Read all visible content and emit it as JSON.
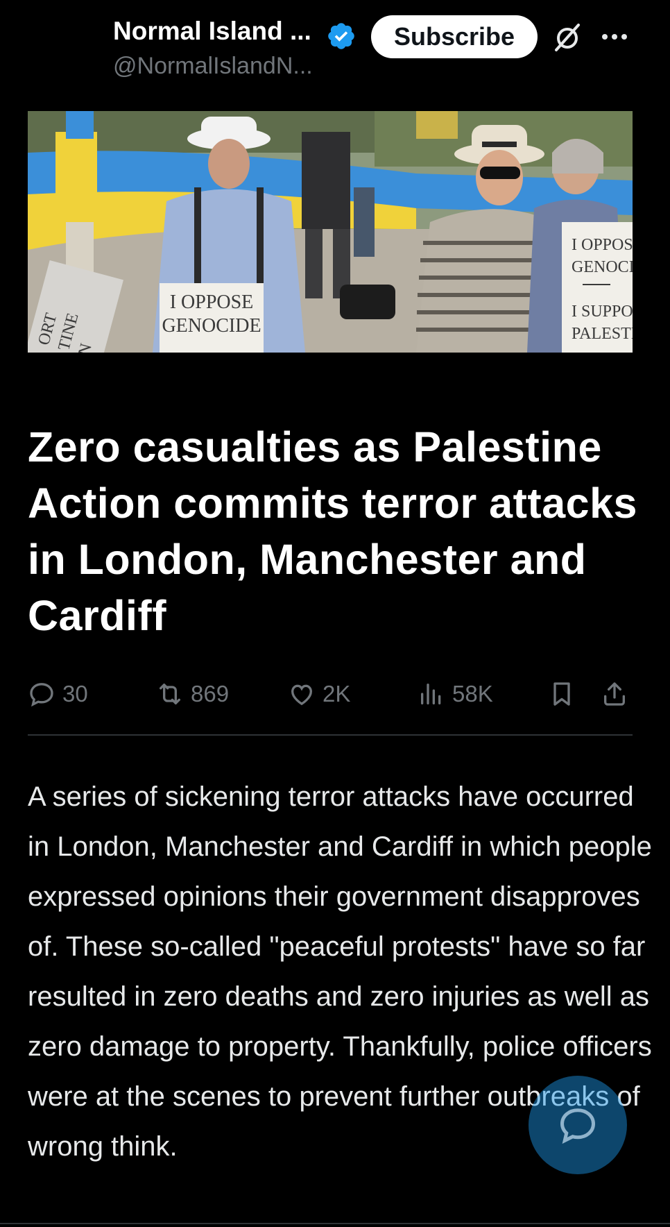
{
  "header": {
    "account_name": "Normal Island ...",
    "handle": "@NormalIslandN...",
    "subscribe_label": "Subscribe"
  },
  "hero_image": {
    "signs": [
      "I OPPOSE",
      "GENOCIDE",
      "I OPPOS",
      "GENOCI",
      "I SUPPO",
      "PALESTI",
      "ORT",
      "TINE",
      "N"
    ]
  },
  "article": {
    "title": "Zero casualties as Palestine Action commits terror attacks in London, Manchester and Cardiff",
    "body": "A series of sickening terror attacks have occurred in London, Manchester and Cardiff in which people expressed opinions their government disapproves of. These so-called \"peaceful protests\" have so far resulted in zero deaths and zero injuries as well as zero damage to property. Thankfully, police officers were at the scenes to prevent further outbreaks of wrong think."
  },
  "actions": {
    "replies": "30",
    "reposts": "869",
    "likes": "2K",
    "views": "58K"
  },
  "colors": {
    "background": "#000000",
    "text": "#e7e9ea",
    "muted": "#71767b",
    "accent": "#1d9bf0"
  },
  "icons": [
    "verified-badge-icon",
    "grok-icon",
    "more-icon",
    "reply-icon",
    "repost-icon",
    "like-icon",
    "views-icon",
    "bookmark-icon",
    "share-icon",
    "compose-reply-icon"
  ]
}
